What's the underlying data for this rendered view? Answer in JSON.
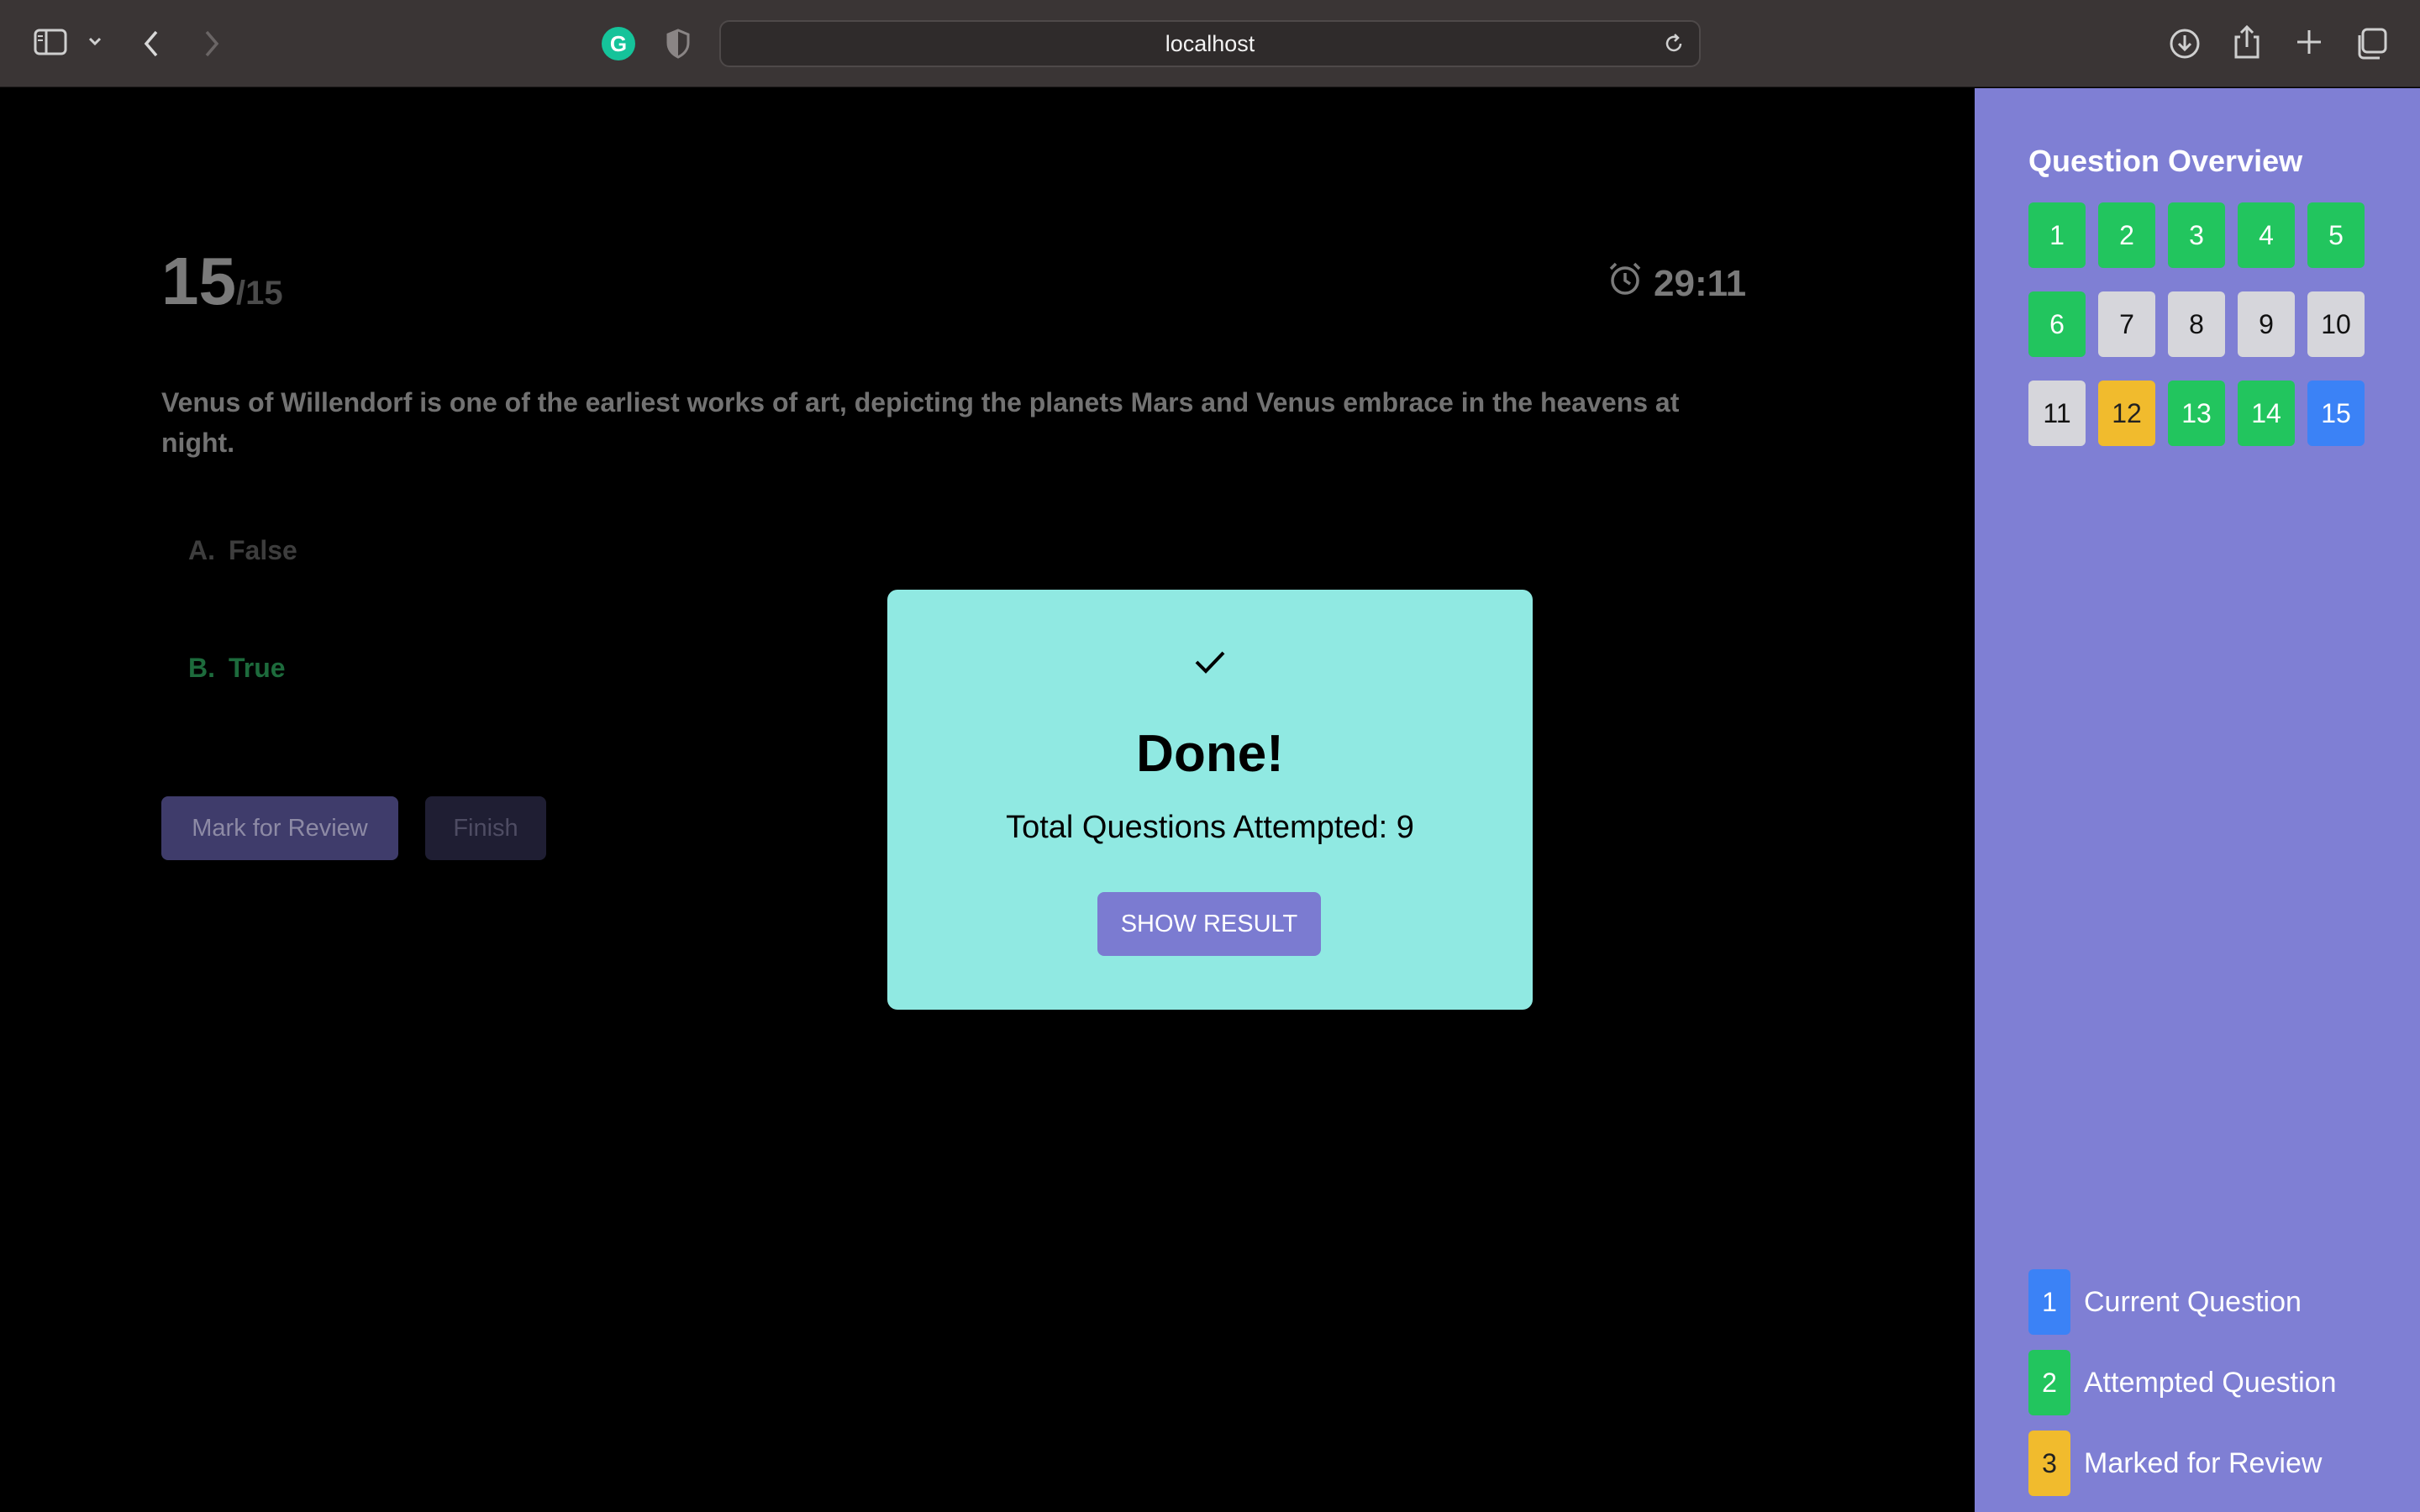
{
  "browser": {
    "url": "localhost"
  },
  "quiz": {
    "current": "15",
    "total": "/15",
    "timer": "29:11",
    "question": "Venus of Willendorf is one of the earliest works of art, depicting the planets Mars and Venus embrace in the heavens at night.",
    "options": [
      {
        "letter": "A.",
        "text": "False"
      },
      {
        "letter": "B.",
        "text": "True"
      }
    ],
    "mark_review_label": "Mark for Review",
    "finish_label": "Finish"
  },
  "modal": {
    "title": "Done!",
    "subtitle": "Total Questions Attempted: 9",
    "button": "SHOW RESULT"
  },
  "overview": {
    "title": "Question Overview",
    "questions": [
      {
        "n": "1",
        "status": "attempted"
      },
      {
        "n": "2",
        "status": "attempted"
      },
      {
        "n": "3",
        "status": "attempted"
      },
      {
        "n": "4",
        "status": "attempted"
      },
      {
        "n": "5",
        "status": "attempted"
      },
      {
        "n": "6",
        "status": "attempted"
      },
      {
        "n": "7",
        "status": "unattempted"
      },
      {
        "n": "8",
        "status": "unattempted"
      },
      {
        "n": "9",
        "status": "unattempted"
      },
      {
        "n": "10",
        "status": "unattempted"
      },
      {
        "n": "11",
        "status": "unattempted"
      },
      {
        "n": "12",
        "status": "review"
      },
      {
        "n": "13",
        "status": "attempted"
      },
      {
        "n": "14",
        "status": "attempted"
      },
      {
        "n": "15",
        "status": "current"
      }
    ],
    "legend": [
      {
        "n": "1",
        "label": "Current Question"
      },
      {
        "n": "2",
        "label": "Attempted Question"
      },
      {
        "n": "3",
        "label": "Marked for Review"
      }
    ]
  },
  "colors": {
    "attempted": "#22c55e",
    "current": "#3b82f6",
    "review": "#f1bb2d",
    "unattempted": "#d6d6db",
    "sidebar": "#7f7fd4",
    "modal": "#90e9e2"
  }
}
